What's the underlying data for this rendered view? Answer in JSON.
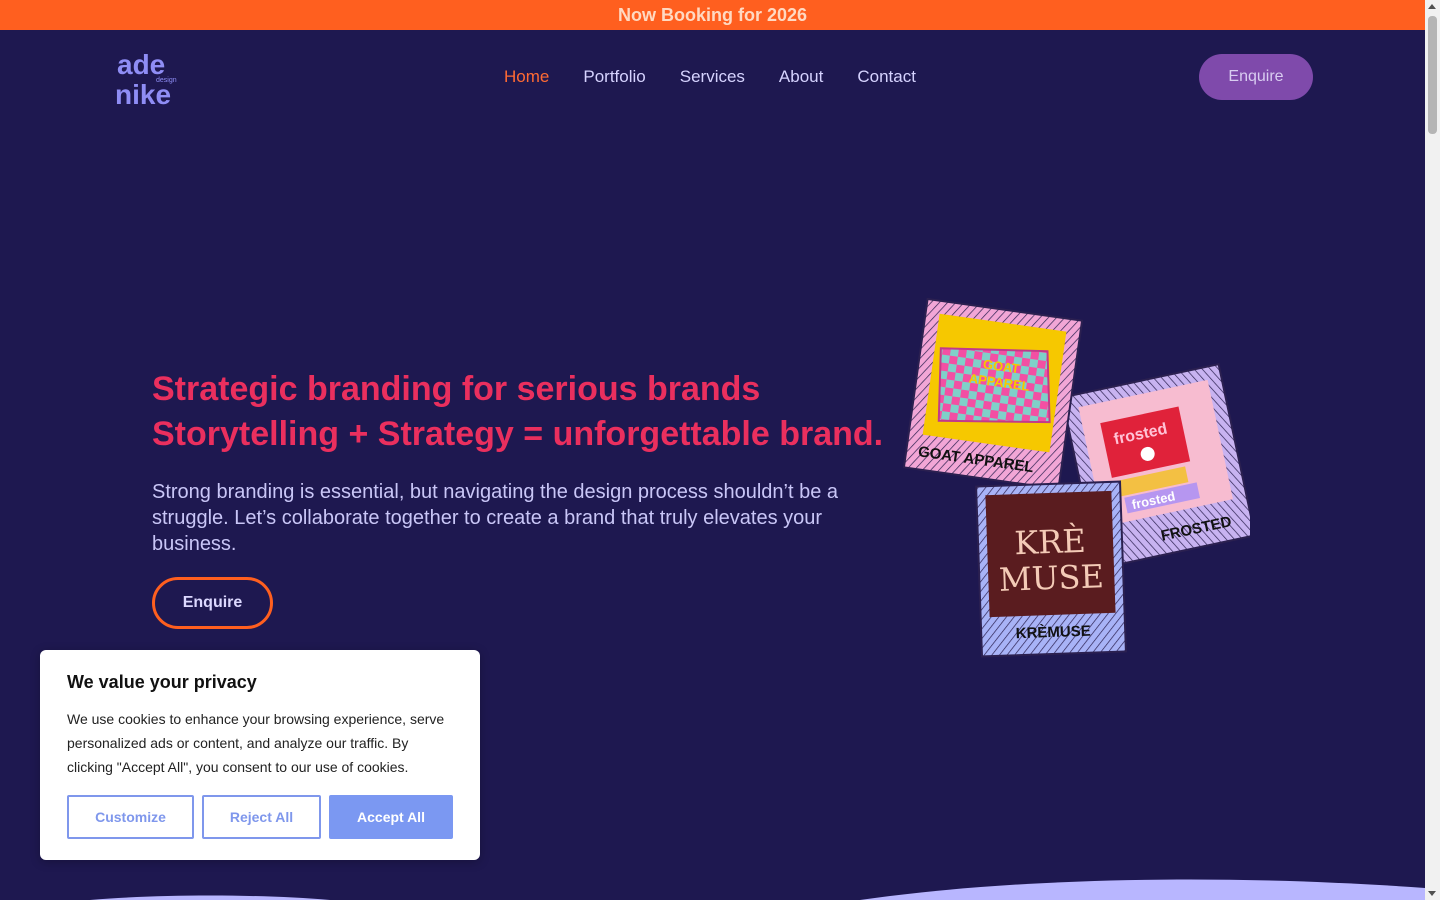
{
  "announcement": "Now Booking for 2026",
  "logo": {
    "line1": "ade",
    "small": "design",
    "line2": "nike"
  },
  "nav": {
    "items": [
      "Home",
      "Portfolio",
      "Services",
      "About",
      "Contact"
    ],
    "active": "Home"
  },
  "header_cta": "Enquire",
  "hero": {
    "headline_line1": "Strategic branding for serious brands",
    "headline_line2": "Storytelling + Strategy = unforgettable brand.",
    "body": "Strong branding is essential, but navigating the design process shouldn’t be a struggle. Let’s collaborate together to create a brand that truly elevates your business.",
    "cta": "Enquire"
  },
  "portfolio_cards": {
    "goat": {
      "caption": "GOAT APPAREL",
      "box_text_1": "GOAT",
      "box_text_2": "APPAREL"
    },
    "frosted": {
      "caption": "FROSTED",
      "box_text_1": "frosted",
      "box_text_2": "frosted"
    },
    "kremuse": {
      "caption": "KRÈMUSE",
      "logo_line1": "KRÈ",
      "logo_line2": "MUSE"
    }
  },
  "cookie_banner": {
    "title": "We value your privacy",
    "body": "We use cookies to enhance your browsing experience, serve personalized ads or content, and analyze our traffic. By clicking \"Accept All\", you consent to our use of cookies.",
    "customize": "Customize",
    "reject": "Reject All",
    "accept": "Accept All"
  },
  "colors": {
    "background": "#1e1850",
    "announcement_bar": "#ff5f1f",
    "headline": "#ea2f5e",
    "nav_active": "#ff6a33",
    "cta_purple": "#7f4aab",
    "cookie_accent": "#7b98f2"
  }
}
